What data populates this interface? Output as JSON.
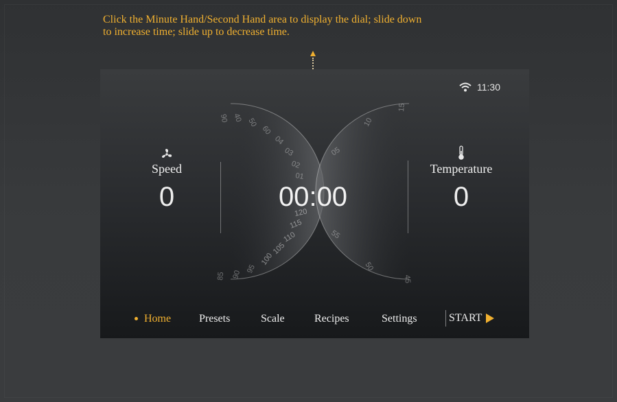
{
  "instruction": {
    "line1": "Click the Minute Hand/Second Hand area to display the dial; slide down",
    "line2": "to increase time; slide up to decrease time."
  },
  "status": {
    "time": "11:30",
    "icon": "wifi-icon"
  },
  "speed": {
    "label": "Speed",
    "value": "0",
    "icon": "fan-icon"
  },
  "temperature": {
    "label": "Temperature",
    "value": "0",
    "icon": "thermometer-icon"
  },
  "timer": {
    "minutes": "00",
    "separator": ":",
    "seconds": "00"
  },
  "dial": {
    "minute_ticks": [
      "90",
      "95",
      "100",
      "105",
      "110",
      "115",
      "120",
      "01",
      "02",
      "03",
      "04",
      "05",
      "06",
      "07",
      "08",
      "09"
    ],
    "second_ticks": [
      "10",
      "05",
      "00",
      "55",
      "50",
      "45",
      "15"
    ]
  },
  "nav": {
    "items": [
      "Home",
      "Presets",
      "Scale",
      "Recipes",
      "Settings"
    ],
    "active": "Home",
    "start_label": "START"
  },
  "colors": {
    "accent": "#f0b030",
    "text": "#f0f0f0",
    "screen_bg": "#2b2d30"
  }
}
